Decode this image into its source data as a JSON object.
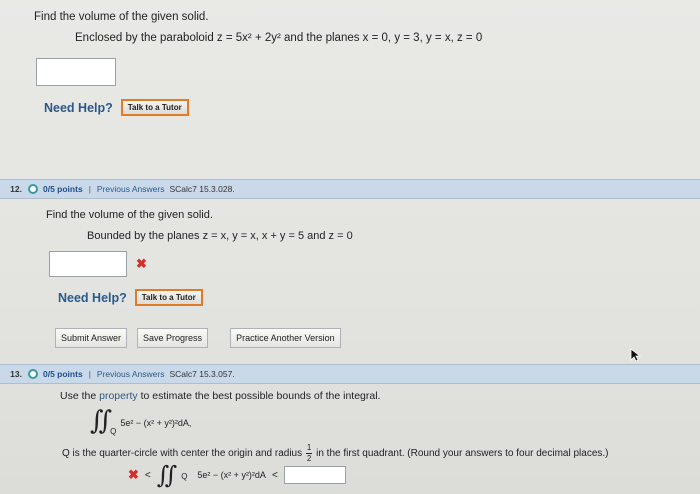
{
  "problem11": {
    "title": "Find the volume of the given solid.",
    "description": "Enclosed by the paraboloid  z = 5x² + 2y²  and the planes  x = 0, y = 3, y = x, z = 0",
    "need_help": "Need Help?",
    "tutor_label": "Talk to a Tutor"
  },
  "problem12": {
    "number": "12.",
    "points": "0/5 points",
    "separator": "|",
    "previous_answers": "Previous Answers",
    "source": "SCalc7 15.3.028.",
    "title": "Find the volume of the given solid.",
    "description": "Bounded by the planes  z = x, y = x, x + y = 5 and z = 0",
    "status_mark": "✖",
    "need_help": "Need Help?",
    "tutor_label": "Talk to a Tutor",
    "buttons": {
      "submit": "Submit Answer",
      "save": "Save Progress",
      "practice": "Practice Another Version"
    }
  },
  "problem13": {
    "number": "13.",
    "points": "0/5 points",
    "separator": "|",
    "previous_answers": "Previous Answers",
    "source": "SCalc7 15.3.057.",
    "title_prefix": "Use the",
    "title_link": "property",
    "title_suffix": "to estimate the best possible bounds of the integral.",
    "integral_symbol": "∬",
    "integral_sub": "Q",
    "integrand": "5e² − (x² + y²)²dA,",
    "desc_prefix": "Q is the quarter-circle with center the origin and radius",
    "frac_num": "1",
    "frac_den": "2",
    "desc_suffix": "in the first quadrant. (Round your answers to four decimal places.)",
    "status_mark": "✖",
    "less_than_1": "<",
    "integrand_bound": "5e² − (x² + y²)²dA",
    "less_than_2": "<"
  },
  "colors": {
    "header_bar": "#c9d9ea",
    "link": "#2b5a8a",
    "error": "#d0312d",
    "tutor_border": "#e07c28"
  }
}
